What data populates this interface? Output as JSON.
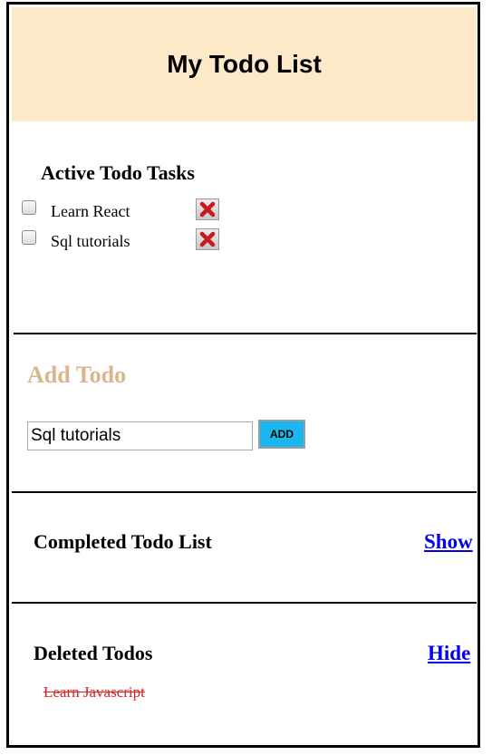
{
  "header": {
    "title": "My Todo List"
  },
  "active": {
    "heading": "Active Todo Tasks",
    "items": [
      {
        "label": "Learn React",
        "checked": false,
        "delete_icon": "red-x-icon"
      },
      {
        "label": "Sql tutorials",
        "checked": false,
        "delete_icon": "red-x-icon"
      }
    ]
  },
  "add": {
    "heading": "Add Todo",
    "input_value": "Sql tutorials",
    "button_label": "ADD"
  },
  "completed": {
    "heading": "Completed Todo List",
    "toggle_label": "Show"
  },
  "deleted": {
    "heading": "Deleted Todos",
    "toggle_label": "Hide",
    "items": [
      "Learn Javascript"
    ]
  },
  "colors": {
    "header_bg": "#fde9c8",
    "add_heading": "#d8b58a",
    "add_button": "#19b6ef",
    "link": "#0000ee",
    "deleted_text": "#e02020",
    "delete_icon": "#c8191e"
  }
}
